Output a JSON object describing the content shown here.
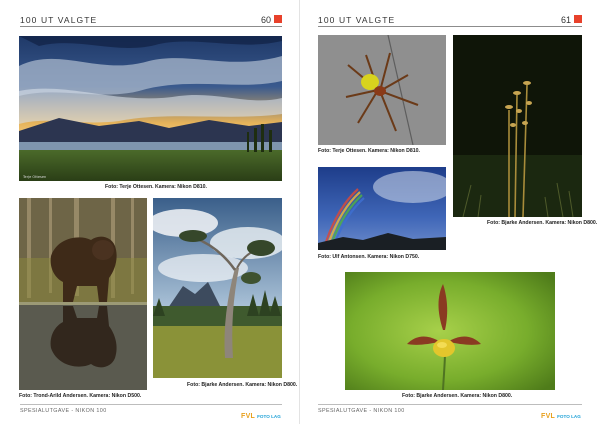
{
  "left_page": {
    "header": {
      "title": "100 UT VALGTE",
      "page_number": "60"
    },
    "footer": {
      "text": "SPESIALUTGAVE - NIKON 100",
      "logo_main": "FVL",
      "logo_sub": "FOTO LAG"
    },
    "captions": {
      "sky": "Foto: Terje Ottesen. Kamera: Nikon D810.",
      "bear": "Foto: Trond-Arild Andersen. Kamera: Nikon D500.",
      "tree": "Foto: Bjarke Andersen. Kamera: Nikon D800."
    },
    "watermark": "Terje Ottesen"
  },
  "right_page": {
    "header": {
      "title": "100 UT VALGTE",
      "page_number": "61"
    },
    "footer": {
      "text": "SPESIALUTGAVE - NIKON 100",
      "logo_main": "FVL",
      "logo_sub": "FOTO LAG"
    },
    "captions": {
      "spider": "Foto: Terje Ottesen. Kamera: Nikon D810.",
      "orchid": "Foto: Bjarke Andersen. Kamera: Nikon D800.",
      "rainbow": "Foto: Ulf Antonsen. Kamera: Nikon D750.",
      "flower": "Foto: Bjarke Andersen. Kamera: Nikon D800."
    }
  },
  "colors": {
    "accent": "#e8412b",
    "logo_orange": "#e8a01c",
    "logo_blue": "#1a9fd6"
  }
}
